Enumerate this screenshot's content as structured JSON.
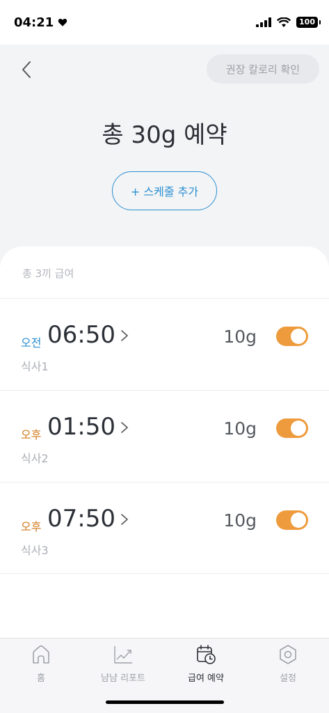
{
  "status": {
    "time": "04:21",
    "battery": "100"
  },
  "header": {
    "calorie_button": "권장 칼로리 확인",
    "total": "총 30g 예약",
    "add_schedule": "+ 스케줄 추가"
  },
  "schedule": {
    "count_label": "총 3끼 급여",
    "items": [
      {
        "period": "오전",
        "time": "06:50",
        "name": "식사1",
        "amount": "10g",
        "enabled": true
      },
      {
        "period": "오후",
        "time": "01:50",
        "name": "식사2",
        "amount": "10g",
        "enabled": true
      },
      {
        "period": "오후",
        "time": "07:50",
        "name": "식사3",
        "amount": "10g",
        "enabled": true
      }
    ]
  },
  "nav": {
    "home": "홈",
    "report": "냠냠 리포트",
    "reservation": "급여 예약",
    "settings": "설정"
  },
  "colors": {
    "am": "#2a8fd1",
    "pm": "#d27a1e",
    "toggle_on": "#ee9b3d"
  }
}
